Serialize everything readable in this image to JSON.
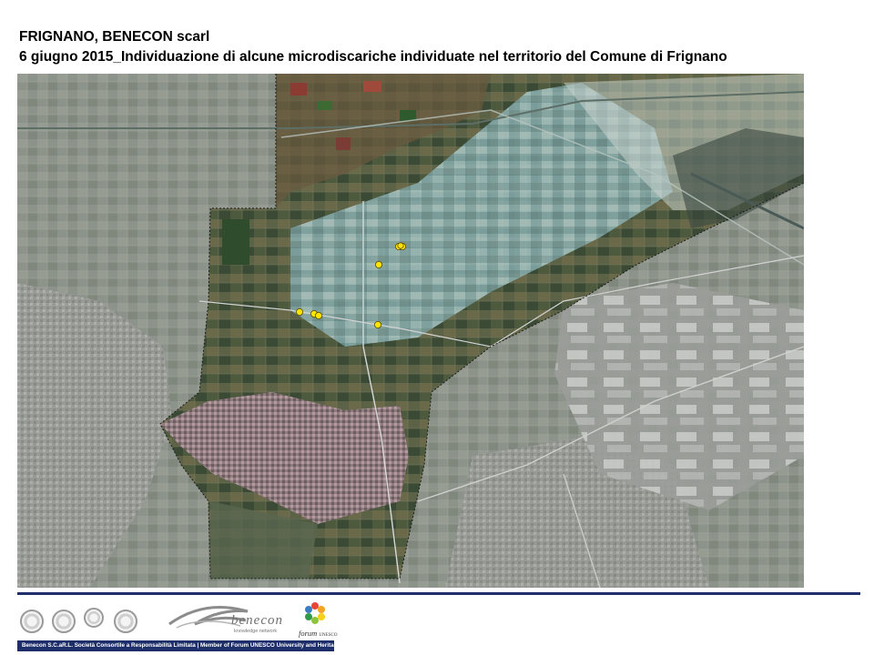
{
  "title": {
    "line1": "FRIGNANO, BENECON scarl",
    "line2": "6 giugno 2015_Individuazione di alcune microdiscariche individuate nel territorio del Comune di Frignano"
  },
  "map": {
    "description_colors": {
      "background_gray": "#8b9289",
      "highlight_area": "#4c5a3f",
      "marker": "#ffe500"
    },
    "marker_count": 8
  },
  "footer": {
    "rule_color": "#1e2f6b",
    "benecon_word": "benecon",
    "benecon_tag": "knowledge network",
    "forum_word": "forum",
    "forum_sub": "UNESCO",
    "bar_text": "Benecon S.C.aR.L. Società Consortile a Responsabilità Limitata | Member of Forum UNESCO University and Heritage"
  }
}
